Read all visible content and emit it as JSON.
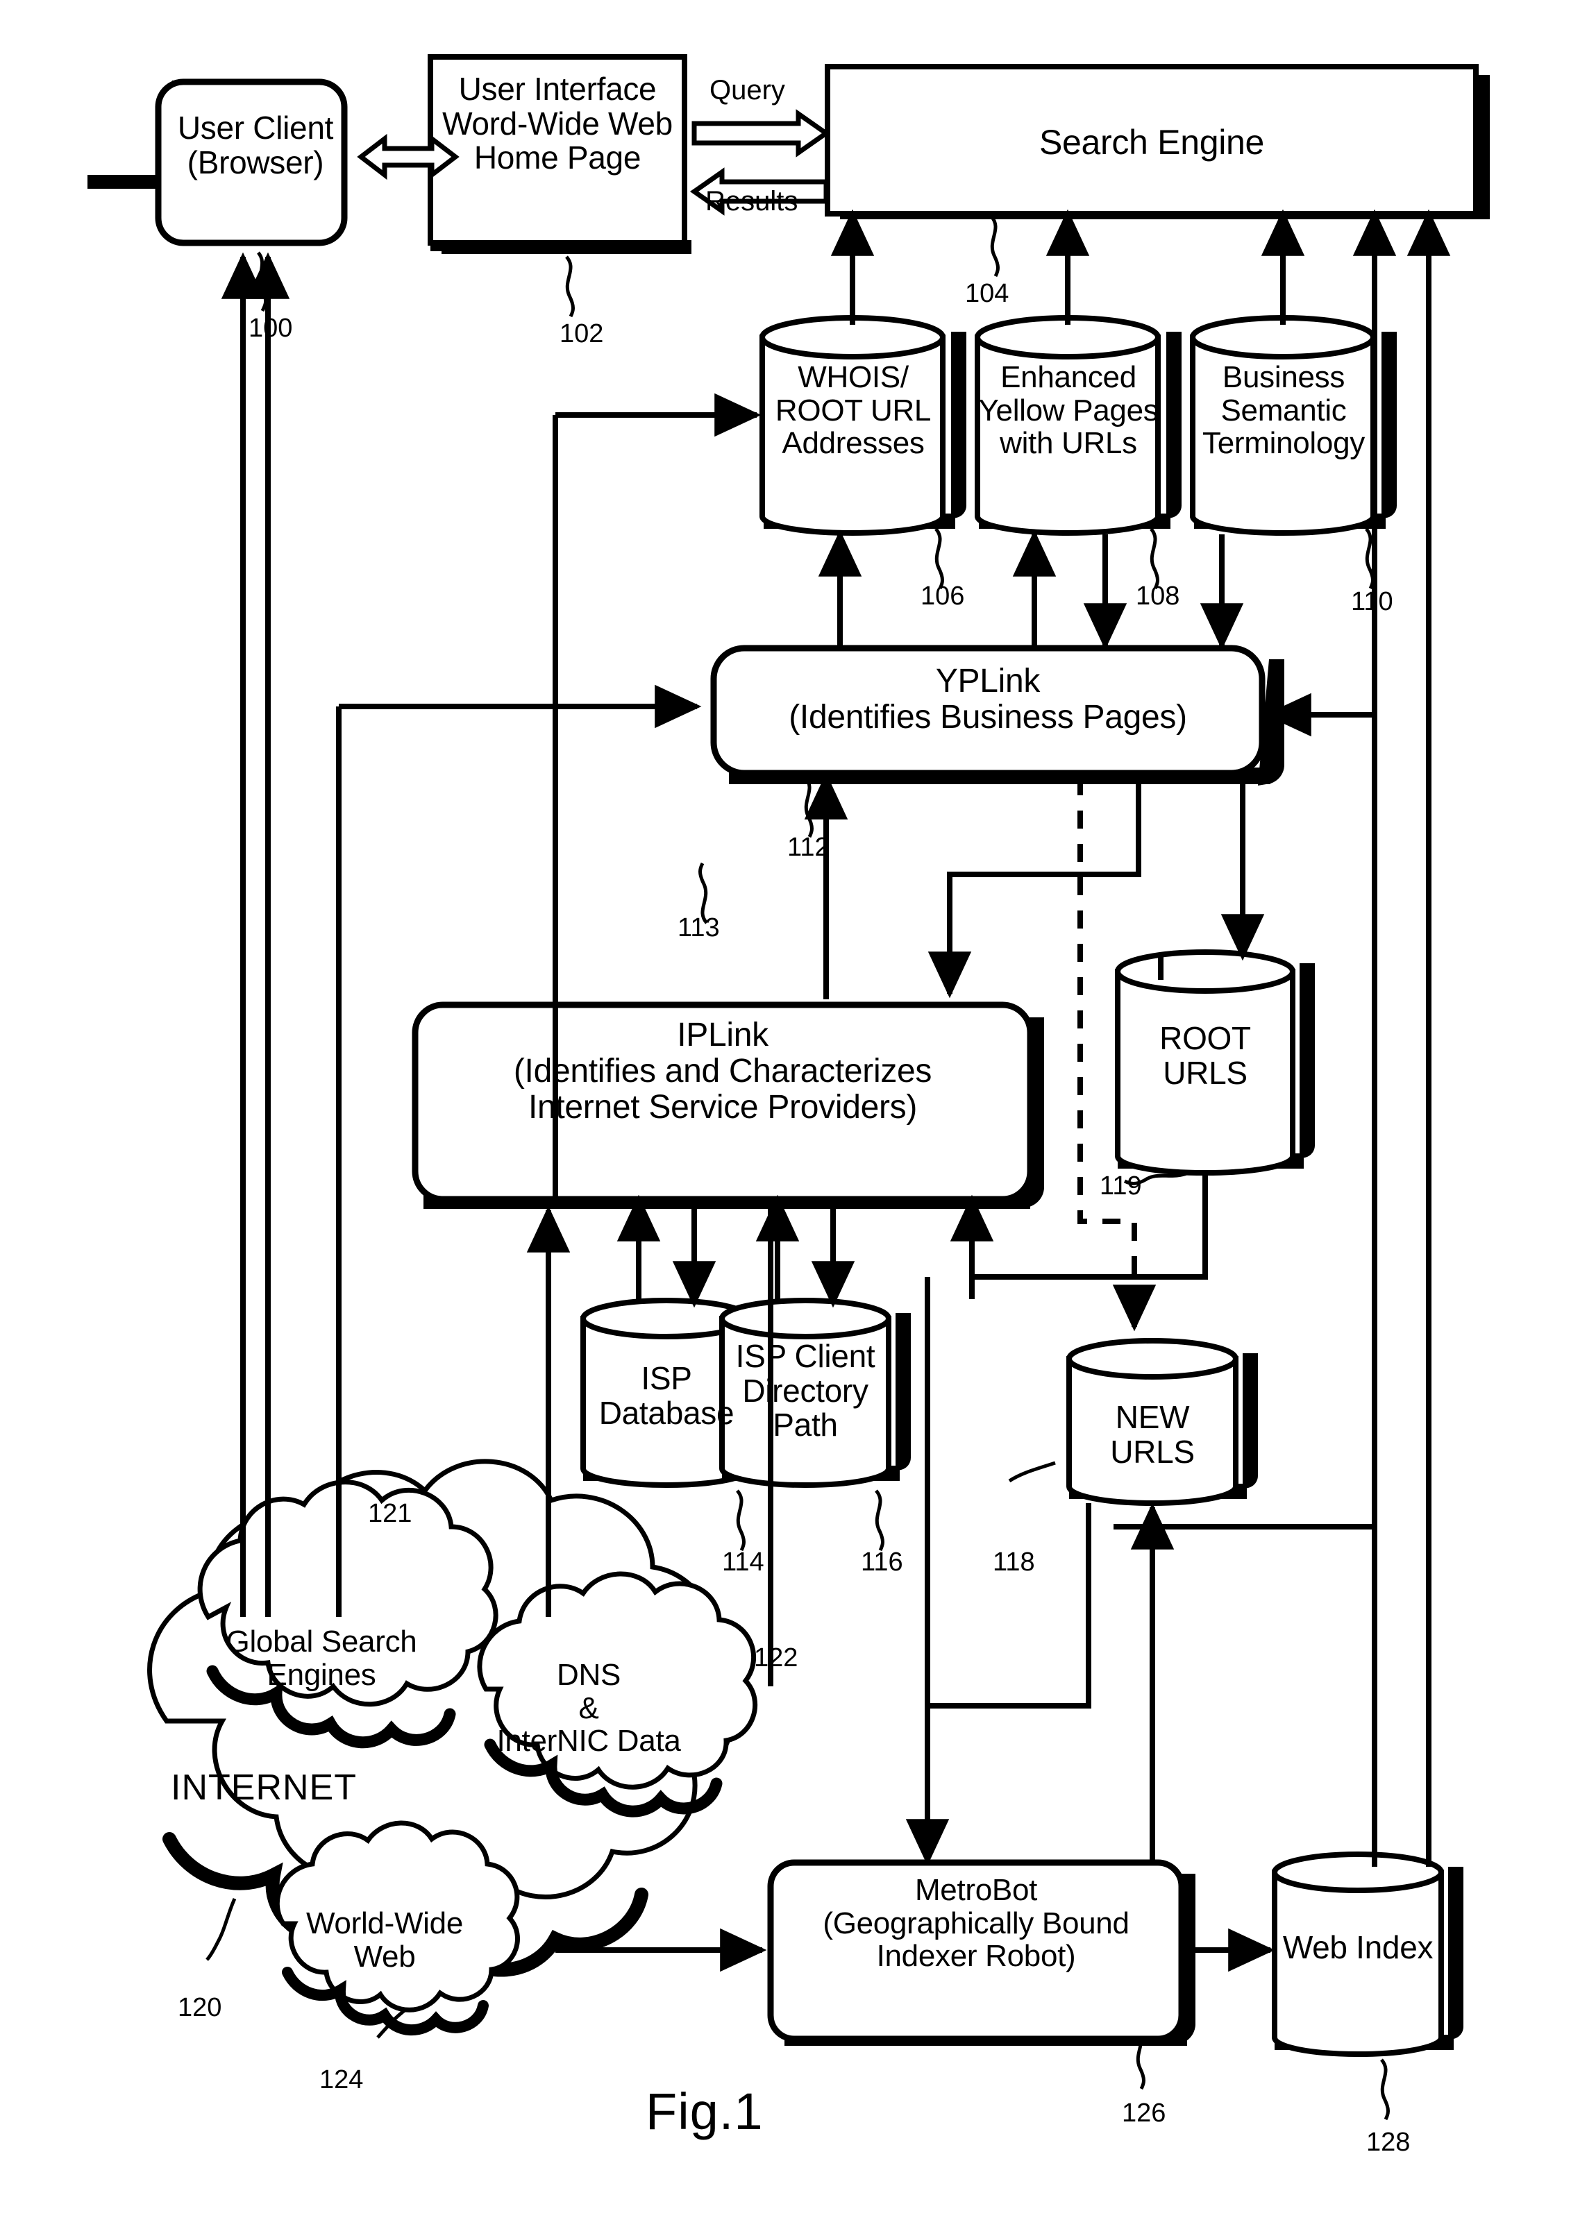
{
  "figure": {
    "caption": "Fig.1"
  },
  "nodes": {
    "user_client": {
      "label": "User Client\n(Browser)",
      "ref": "100"
    },
    "user_interface": {
      "label": "User Interface\nWord-Wide Web\nHome Page",
      "ref": "102"
    },
    "search_engine": {
      "label": "Search Engine",
      "ref": "104"
    },
    "whois_root_url": {
      "label": "WHOIS/\nROOT URL\nAddresses",
      "ref": "106"
    },
    "enhanced_yellow_pages": {
      "label": "Enhanced\nYellow Pages\nwith URLs",
      "ref": "108"
    },
    "business_semantic": {
      "label": "Business\nSemantic\nTerminology",
      "ref": "110"
    },
    "yplink": {
      "label": "YPLink\n(Identifies Business Pages)",
      "ref": "112"
    },
    "iplink": {
      "label": "IPLink\n(Identifies and Characterizes\nInternet Service Providers)",
      "ref": "113"
    },
    "root_urls": {
      "label": "ROOT\nURLS",
      "ref": "119"
    },
    "isp_database": {
      "label": "ISP\nDatabase",
      "ref": "114"
    },
    "isp_client_directory_path": {
      "label": "ISP Client\nDirectory\nPath",
      "ref": "116"
    },
    "new_urls": {
      "label": "NEW\nURLS",
      "ref": "118"
    },
    "internet": {
      "label": "INTERNET",
      "ref": "120"
    },
    "global_search_engines": {
      "label": "Global Search\nEngines",
      "ref": "121"
    },
    "dns_internic": {
      "label": "DNS\n&\nInterNIC Data",
      "ref": "122"
    },
    "world_wide_web": {
      "label": "World-Wide\nWeb",
      "ref": "124"
    },
    "metrobot": {
      "label": "MetroBot\n(Geographically Bound\nIndexer Robot)",
      "ref": "126"
    },
    "web_index": {
      "label": "Web Index",
      "ref": "128"
    }
  },
  "edge_labels": {
    "query": "Query",
    "results": "Results"
  },
  "colors": {
    "stroke": "#000000",
    "fill": "#ffffff",
    "shadow": "#000000"
  }
}
